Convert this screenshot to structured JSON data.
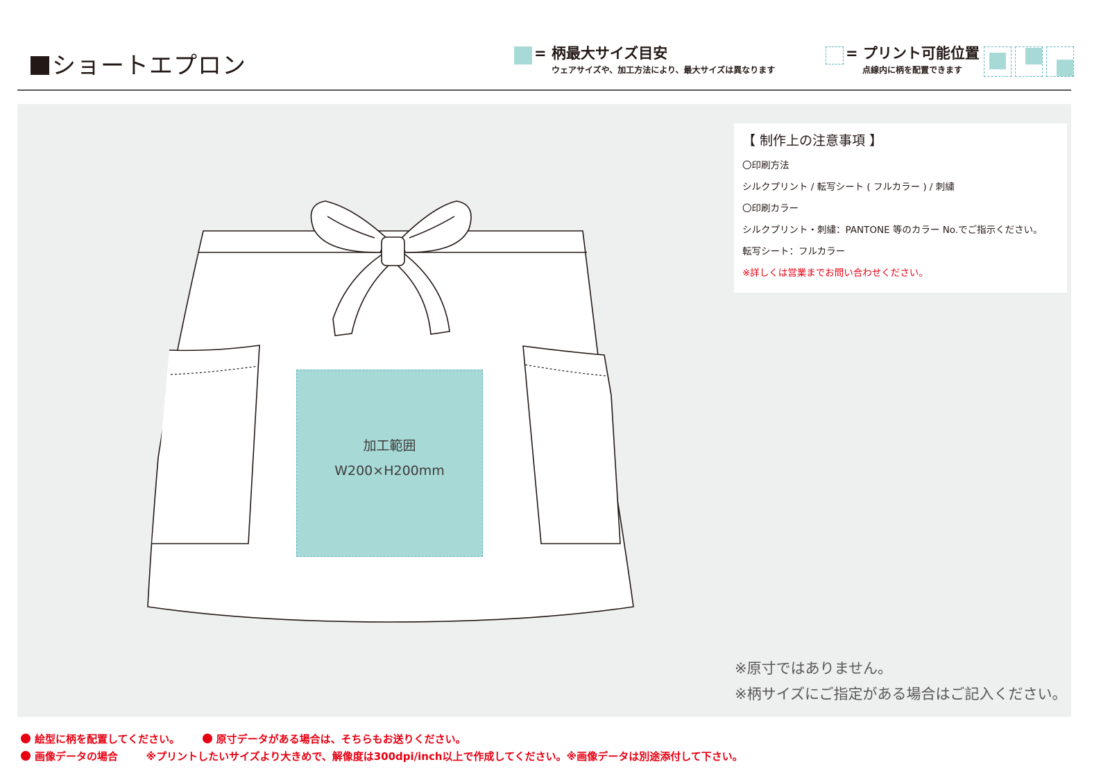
{
  "header": {
    "title": "ショートエプロン",
    "legend_max_size": {
      "label": "= 柄最大サイズ目安",
      "note": "ウェアサイズや、加工方法により、最大サイズは異なります"
    },
    "legend_print_position": {
      "label": "= プリント可能位置",
      "note": "点線内に柄を配置できます"
    }
  },
  "notes": {
    "heading": "【 制作上の注意事項 】",
    "lines": [
      "〇印刷方法",
      "シルクプリント / 転写シート ( フルカラー ) / 刺繍",
      "〇印刷カラー",
      "シルクプリント・刺繍：PANTONE 等のカラー No.でご指示ください。",
      "転写シート：フルカラー"
    ],
    "warning": "※詳しくは営業までお問い合わせください。"
  },
  "print_area": {
    "label": "加工範囲",
    "size": "W200×H200mm"
  },
  "disclaimers": [
    "※原寸ではありません。",
    "※柄サイズにご指定がある場合はご記入ください。"
  ],
  "footer": {
    "item1": "絵型に柄を配置してください。",
    "item2": "原寸データがある場合は、そちらもお送りください。",
    "item3_title": "画像データの場合",
    "item3_text": "※プリントしたいサイズより大きめで、解像度は300dpi/inch以上で作成してください。※画像データは別途添付して下さい。"
  },
  "colors": {
    "print_area_fill": "#a7dad7",
    "print_area_border": "#5bb5c4",
    "panel_bg": "#eeefef",
    "warning_red": "#e60012"
  }
}
